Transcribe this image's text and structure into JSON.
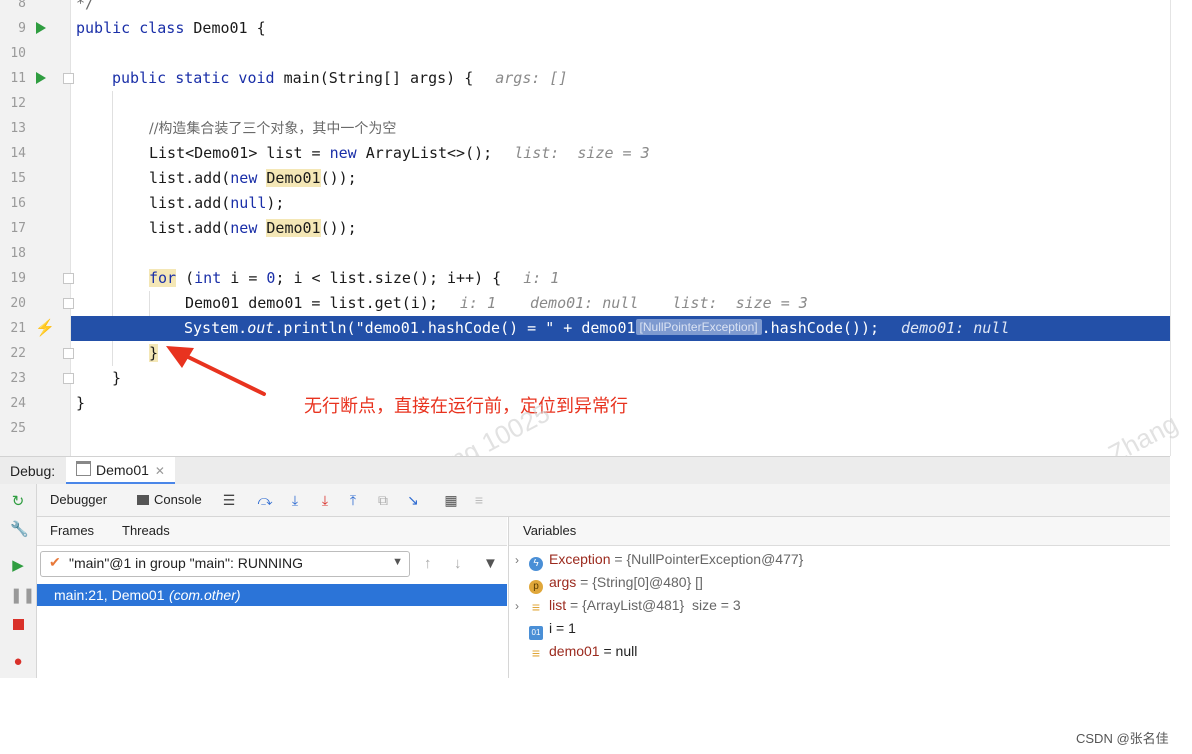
{
  "editor": {
    "line_numbers": [
      "8",
      "9",
      "10",
      "11",
      "12",
      "13",
      "14",
      "15",
      "16",
      "17",
      "18",
      "19",
      "20",
      "21",
      "22",
      "23",
      "24",
      "25"
    ],
    "lines": {
      "l8": "*/",
      "l9_kw": "public class ",
      "l9_rest": "Demo01 {",
      "l11_kw": "public static void ",
      "l11_rest": "main(String[] args) {",
      "l11_hint": "args: []",
      "l13": "//构造集合装了三个对象，其中一个为空",
      "l14_a": "List<Demo01> list = ",
      "l14_kw": "new",
      "l14_b": " ArrayList<>();",
      "l14_hint": "list:  size = 3",
      "l15_a": "list.add(",
      "l15_kw": "new",
      "l15_sp": " ",
      "l15_cls": "Demo01",
      "l15_b": "());",
      "l16_a": "list.add(",
      "l16_kw": "null",
      "l16_b": ");",
      "l17_a": "list.add(",
      "l17_kw": "new",
      "l17_sp": " ",
      "l17_cls": "Demo01",
      "l17_b": "());",
      "l19_kw": "for",
      "l19_a": " (",
      "l19_kw2": "int",
      "l19_b": " i = ",
      "l19_num": "0",
      "l19_c": "; i < list.size(); i++) {",
      "l19_hint": "i: 1",
      "l20_a": "Demo01 demo01 = list.get(i);",
      "l20_hint1": "i: 1",
      "l20_hint2": "demo01: null",
      "l20_hint3": "list:  size = 3",
      "l21_a": "System.",
      "l21_out": "out",
      "l21_b": ".println(\"demo01.hashCode() = \" + demo01",
      "l21_tag": "[NullPointerException]",
      "l21_c": ".hashCode());",
      "l21_hint": "demo01: null",
      "l22": "}",
      "l23": "}",
      "l24": "}"
    },
    "annotation": "无行断点，直接在运行前，定位到异常行"
  },
  "debug": {
    "label": "Debug:",
    "session_tab": "Demo01",
    "tabs": {
      "debugger": "Debugger",
      "console": "Console"
    },
    "frames_tab": "Frames",
    "threads_tab": "Threads",
    "variables_title": "Variables",
    "thread_selected": "\"main\"@1 in group \"main\": RUNNING",
    "frame_loc": "main:21, Demo01",
    "frame_pkg": "(com.other)",
    "variables": [
      {
        "name": "Exception",
        "value": " = {NullPointerException@477}"
      },
      {
        "name": "args",
        "value": " = {String[0]@480} []"
      },
      {
        "name": "list",
        "value": " = {ArrayList@481}  size = 3"
      },
      {
        "name": "i",
        "value": " = 1"
      },
      {
        "name": "demo01",
        "value": " = null"
      }
    ]
  },
  "watermark": "Mingo Zhang 10025",
  "watermark2": "Mingo Zhang 10025",
  "footer": "CSDN @张名佳",
  "colors": {
    "accent": "#2350a8",
    "annotation": "#e8331f",
    "selection": "#2b74d8"
  }
}
